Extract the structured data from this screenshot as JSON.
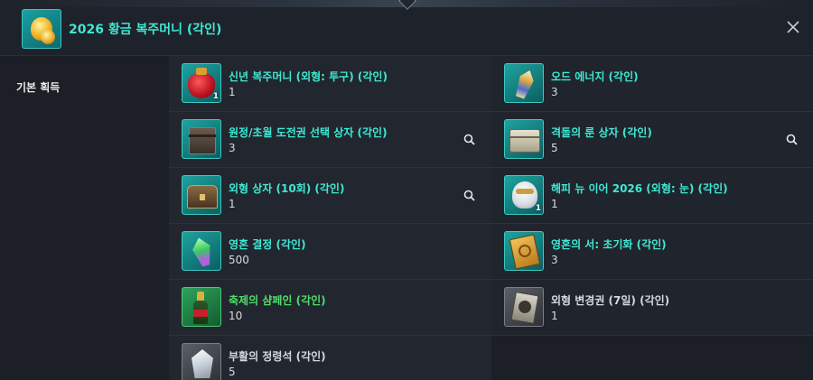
{
  "header": {
    "title": "2026 황금 복주머니 (각인)",
    "icon": "golden-pouch-icon",
    "close_icon": "close-icon"
  },
  "sidebar": {
    "section_label": "기본 획득"
  },
  "colors": {
    "accent_teal": "#3ee8d4",
    "accent_green": "#4fdc6a",
    "text_gray": "#d6d8dc",
    "background": "#1c1f26"
  },
  "items": [
    {
      "name": "신년 복주머니 (외형: 투구) (각인)",
      "count": "1",
      "badge": "1",
      "rarity": "teal",
      "icon": "red-pouch-icon",
      "searchable": false
    },
    {
      "name": "오드 에너지 (각인)",
      "count": "3",
      "badge": "",
      "rarity": "teal",
      "icon": "crystal-icon",
      "searchable": false
    },
    {
      "name": "원정/초월 도전권 선택 상자 (각인)",
      "count": "3",
      "badge": "",
      "rarity": "teal",
      "icon": "dark-box-icon",
      "searchable": true
    },
    {
      "name": "격돌의 룬 상자 (각인)",
      "count": "5",
      "badge": "",
      "rarity": "teal",
      "icon": "chest-icon",
      "searchable": true
    },
    {
      "name": "외형 상자 (10회) (각인)",
      "count": "1",
      "badge": "",
      "rarity": "teal",
      "icon": "treasure-chest-icon",
      "searchable": true
    },
    {
      "name": "해피 뉴 이어 2026 (외형: 눈) (각인)",
      "count": "1",
      "badge": "1",
      "rarity": "teal",
      "icon": "mask-icon",
      "searchable": false
    },
    {
      "name": "영혼 결정 (각인)",
      "count": "500",
      "badge": "",
      "rarity": "teal",
      "icon": "soul-crystal-icon",
      "searchable": false
    },
    {
      "name": "영혼의 서: 초기화 (각인)",
      "count": "3",
      "badge": "",
      "rarity": "teal",
      "icon": "book-icon",
      "searchable": false
    },
    {
      "name": "축제의 샴페인 (각인)",
      "count": "10",
      "badge": "",
      "rarity": "green",
      "icon": "champagne-icon",
      "searchable": false
    },
    {
      "name": "외형 변경권 (7일) (각인)",
      "count": "1",
      "badge": "",
      "rarity": "gray",
      "icon": "ticket-icon",
      "searchable": false
    },
    {
      "name": "부활의 정령석 (각인)",
      "count": "5",
      "badge": "",
      "rarity": "gray",
      "icon": "spirit-stone-icon",
      "searchable": false
    }
  ]
}
